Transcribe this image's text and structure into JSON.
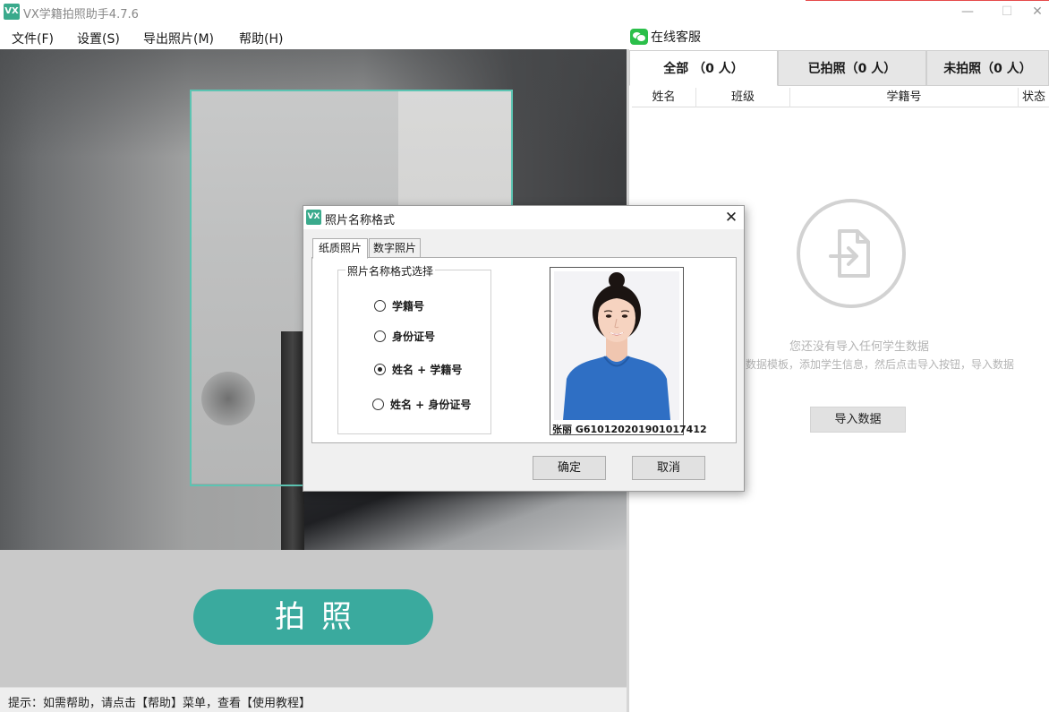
{
  "window": {
    "logo_text": "VX",
    "title": "VX学籍拍照助手4.7.6",
    "min_glyph": "—",
    "max_glyph": "☐",
    "close_glyph": "✕"
  },
  "menu": {
    "items": [
      "文件(F)",
      "设置(S)",
      "导出照片(M)",
      "帮助(H)"
    ],
    "service_label": "在线客服"
  },
  "capture": {
    "button_label": "拍照"
  },
  "status": {
    "text": "提示：如需帮助，请点击【帮助】菜单，查看【使用教程】"
  },
  "right_panel": {
    "tabs": [
      {
        "label": "全部 （0 人）",
        "active": true
      },
      {
        "label": "已拍照（0 人）",
        "active": false
      },
      {
        "label": "未拍照（0 人）",
        "active": false
      }
    ],
    "columns": [
      "姓名",
      "班级",
      "学籍号",
      "状态"
    ],
    "empty_title": "您还没有导入任何学生数据",
    "empty_desc": "数据模板，添加学生信息，然后点击导入按钮，导入数据",
    "import_button": "导入数据"
  },
  "dialog": {
    "logo_text": "VX",
    "title": "照片名称格式",
    "close_glyph": "✕",
    "tabs": [
      "纸质照片",
      "数字照片"
    ],
    "group_label": "照片名称格式选择",
    "options": [
      {
        "label": "学籍号",
        "checked": false
      },
      {
        "label": "身份证号",
        "checked": false
      },
      {
        "label": "姓名 + 学籍号",
        "checked": true
      },
      {
        "label": "姓名 + 身份证号",
        "checked": false
      }
    ],
    "photo_caption": "张丽 G610120201901017412",
    "ok_button": "确定",
    "cancel_button": "取消"
  },
  "colors": {
    "accent": "#3aaa9e",
    "crop_frame": "#5cc4b2",
    "wechat": "#2bbf4a"
  }
}
